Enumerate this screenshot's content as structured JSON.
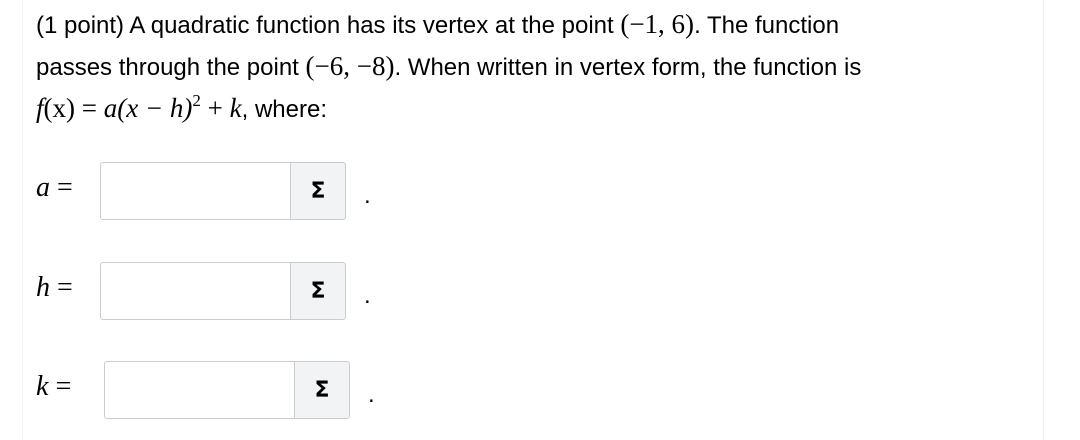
{
  "problem": {
    "line1_text": "(1 point) A quadratic function has its vertex at the point ",
    "vertex": "(−1, 6)",
    "line1_tail": ". The function",
    "line2_text": "passes through the point ",
    "point": "(−6, −8)",
    "line2_tail": ". When written in vertex form, the function is",
    "formula_f": "f",
    "formula_x": "(x) = ",
    "formula_a": "a",
    "formula_open": "(x − h)",
    "formula_exp": "2",
    "formula_plus": " + ",
    "formula_k": "k",
    "formula_tail": ", where:"
  },
  "answers": [
    {
      "var": "a",
      "eq": " =",
      "value": "",
      "button_icon": "Σ",
      "trail": "."
    },
    {
      "var": "h",
      "eq": " =",
      "value": "",
      "button_icon": "Σ",
      "trail": "."
    },
    {
      "var": "k",
      "eq": " =",
      "value": "",
      "button_icon": "Σ",
      "trail": "."
    }
  ]
}
